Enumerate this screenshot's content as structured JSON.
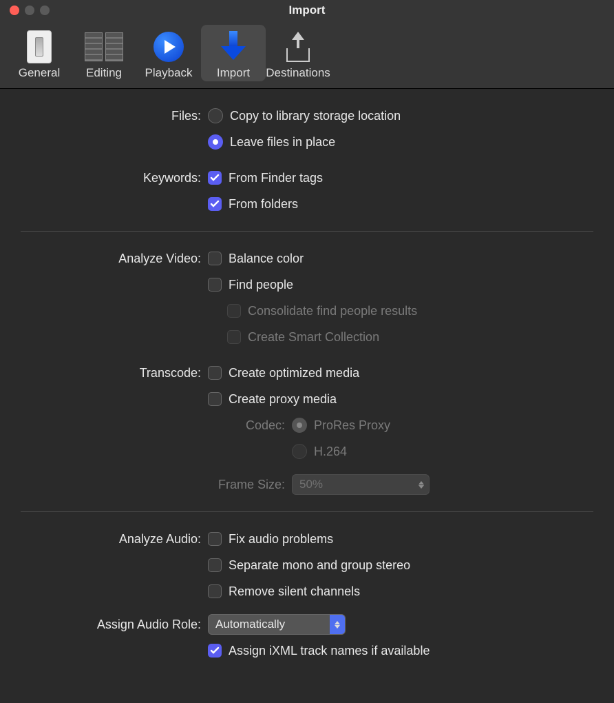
{
  "window": {
    "title": "Import"
  },
  "toolbar": {
    "items": [
      {
        "label": "General"
      },
      {
        "label": "Editing"
      },
      {
        "label": "Playback"
      },
      {
        "label": "Import"
      },
      {
        "label": "Destinations"
      }
    ],
    "selected": "Import"
  },
  "files": {
    "label": "Files:",
    "copy": "Copy to library storage location",
    "leave": "Leave files in place",
    "selected": "leave"
  },
  "keywords": {
    "label": "Keywords:",
    "finder": {
      "label": "From Finder tags",
      "checked": true
    },
    "folders": {
      "label": "From folders",
      "checked": true
    }
  },
  "analyzeVideo": {
    "label": "Analyze Video:",
    "balance": {
      "label": "Balance color",
      "checked": false
    },
    "findPeople": {
      "label": "Find people",
      "checked": false
    },
    "consolidate": {
      "label": "Consolidate find people results",
      "checked": false,
      "enabled": false
    },
    "smart": {
      "label": "Create Smart Collection",
      "checked": false,
      "enabled": false
    }
  },
  "transcode": {
    "label": "Transcode:",
    "optimized": {
      "label": "Create optimized media",
      "checked": false
    },
    "proxy": {
      "label": "Create proxy media",
      "checked": false
    },
    "codec": {
      "label": "Codec:",
      "prores": "ProRes Proxy",
      "h264": "H.264",
      "selected": "prores",
      "enabled": false
    },
    "frameSize": {
      "label": "Frame Size:",
      "value": "50%",
      "enabled": false
    }
  },
  "analyzeAudio": {
    "label": "Analyze Audio:",
    "fix": {
      "label": "Fix audio problems",
      "checked": false
    },
    "separate": {
      "label": "Separate mono and group stereo",
      "checked": false
    },
    "remove": {
      "label": "Remove silent channels",
      "checked": false
    }
  },
  "assignRole": {
    "label": "Assign Audio Role:",
    "value": "Automatically",
    "ixml": {
      "label": "Assign iXML track names if available",
      "checked": true
    }
  }
}
